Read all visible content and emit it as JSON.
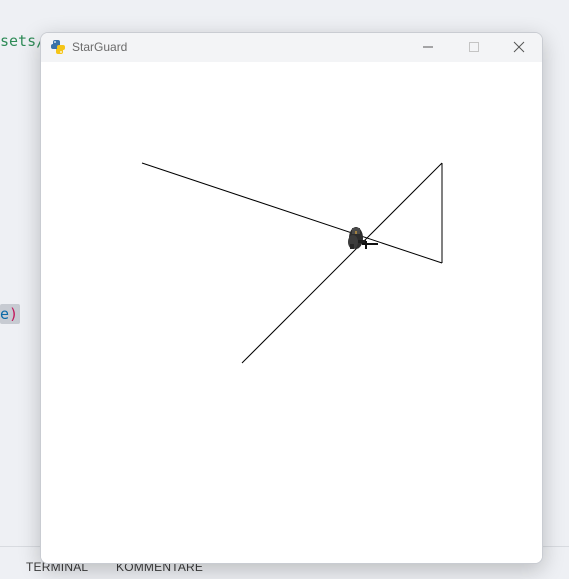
{
  "editor": {
    "fragment_top": "sets/",
    "fragment_mid_text": "e",
    "fragment_mid_paren": ")"
  },
  "panel": {
    "tabs": [
      "TERMINAL",
      "KOMMENTARE"
    ]
  },
  "window": {
    "title": "StarGuard",
    "icon": "python-icon",
    "controls": [
      "minimize-icon",
      "maximize-icon",
      "close-icon"
    ]
  },
  "game": {
    "background": "#ffffff",
    "line_color": "#000000",
    "sprite": "player-ship-sprite"
  }
}
